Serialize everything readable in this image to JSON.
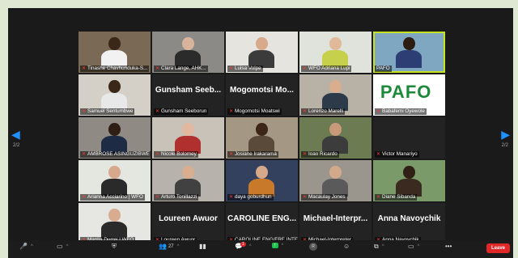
{
  "gallery": {
    "tiles": [
      {
        "label": "Tinashe Chavhunduka-S...",
        "muted": true,
        "bg": "#7a6a55",
        "skin": "#3a2718",
        "shirt": "#f2f2f2",
        "active": false
      },
      {
        "label": "Clara Lange, AHK...",
        "muted": true,
        "bg": "#8c8a86",
        "skin": "#d8b49c",
        "shirt": "#2b2b2b",
        "active": false
      },
      {
        "label": "Luisa Volpe",
        "muted": true,
        "bg": "#e6e4df",
        "skin": "#d9a98b",
        "shirt": "#3b3b3b",
        "active": false
      },
      {
        "label": "WFO Adriana Lupi",
        "muted": true,
        "bg": "#dfe3dc",
        "skin": "#e0b89a",
        "shirt": "#c7d04a",
        "active": false
      },
      {
        "label": "PAFO",
        "muted": false,
        "bg": "#7fa7c2",
        "skin": "#2c1c12",
        "shirt": "#2c3e73",
        "active": true
      },
      {
        "label": "Samuel Sentumbwe",
        "muted": true,
        "bg": "#d4d0c8",
        "skin": "#3a2718",
        "shirt": "#e8e8e8",
        "active": false
      },
      {
        "label": "Gunsham Seeborun",
        "muted": true,
        "bigname": "Gunsham Seeb...",
        "active": false
      },
      {
        "label": "Mogomotsi Moatswi",
        "muted": true,
        "bigname": "Mogomotsi Mo...",
        "active": false
      },
      {
        "label": "Lorenzo Marelli",
        "muted": true,
        "bg": "#b8b1a6",
        "skin": "#d9ae8f",
        "shirt": "#2d3a4a",
        "active": false
      },
      {
        "label": "Babafemi Oyewole",
        "muted": true,
        "logo": "PAFO",
        "active": false
      },
      {
        "label": "AMBROSE ASINGUZIBWE",
        "muted": true,
        "bg": "#8f8a84",
        "skin": "#2e1e14",
        "shirt": "#1e2b45",
        "active": false
      },
      {
        "label": "Nicole Bolomey",
        "muted": true,
        "bg": "#c9c2b8",
        "skin": "#e2b8a0",
        "shirt": "#b03030",
        "active": false
      },
      {
        "label": "Josiane Irakarama",
        "muted": true,
        "bg": "#a49884",
        "skin": "#3b2617",
        "shirt": "#5a4a3a",
        "active": false
      },
      {
        "label": "Ioao Ricardo",
        "muted": true,
        "bg": "#6d7b52",
        "skin": "#c99a7a",
        "shirt": "#3c3c3c",
        "active": false
      },
      {
        "label": "Victor Manariyo",
        "muted": true,
        "empty": true,
        "active": false
      },
      {
        "label": "Arianna Acciarino | WFO",
        "muted": true,
        "bg": "#e4e6e0",
        "skin": "#d8a88c",
        "shirt": "#2a2a2a",
        "active": false
      },
      {
        "label": "Arturo Tonillazzi",
        "muted": true,
        "bg": "#b7b2ab",
        "skin": "#d9ae8f",
        "shirt": "#414141",
        "active": false
      },
      {
        "label": "daya goburdhun",
        "muted": true,
        "bg": "#33415f",
        "skin": "#d5a98a",
        "shirt": "#c87a2a",
        "active": false
      },
      {
        "label": "Macaulay Jones",
        "muted": true,
        "bg": "#9a958d",
        "skin": "#d4a88a",
        "shirt": "#5a5a5a",
        "active": false
      },
      {
        "label": "Diane Sibanda",
        "muted": true,
        "bg": "#7a9a6a",
        "skin": "#2f1f15",
        "shirt": "#3a2a20",
        "active": false
      },
      {
        "label": "Manlia Durrei | WFO",
        "muted": true,
        "bg": "#e6e6e2",
        "skin": "#d8ac90",
        "shirt": "#2a2a2a",
        "active": false
      },
      {
        "label": "Loureen Awuor",
        "muted": true,
        "bigname": "Loureen Awuor",
        "active": false
      },
      {
        "label": "CAROLINE ENG/FRE INTERP...",
        "muted": true,
        "bigname": "CAROLINE ENG...",
        "active": false
      },
      {
        "label": "Michael-Interpreter",
        "muted": true,
        "bigname": "Michael-Interpr...",
        "active": false
      },
      {
        "label": "Anna Navoychik",
        "muted": true,
        "bigname": "Anna Navoychik",
        "active": false
      }
    ]
  },
  "pager": {
    "left": "2/2",
    "right": "2/2"
  },
  "toolbar": {
    "participants_count": "27",
    "chat_count": "1",
    "leave_label": "Leave"
  },
  "colors": {
    "accent_border": "#c7e21e",
    "muted_icon": "#ff3b30",
    "leave_button": "#e02828"
  }
}
